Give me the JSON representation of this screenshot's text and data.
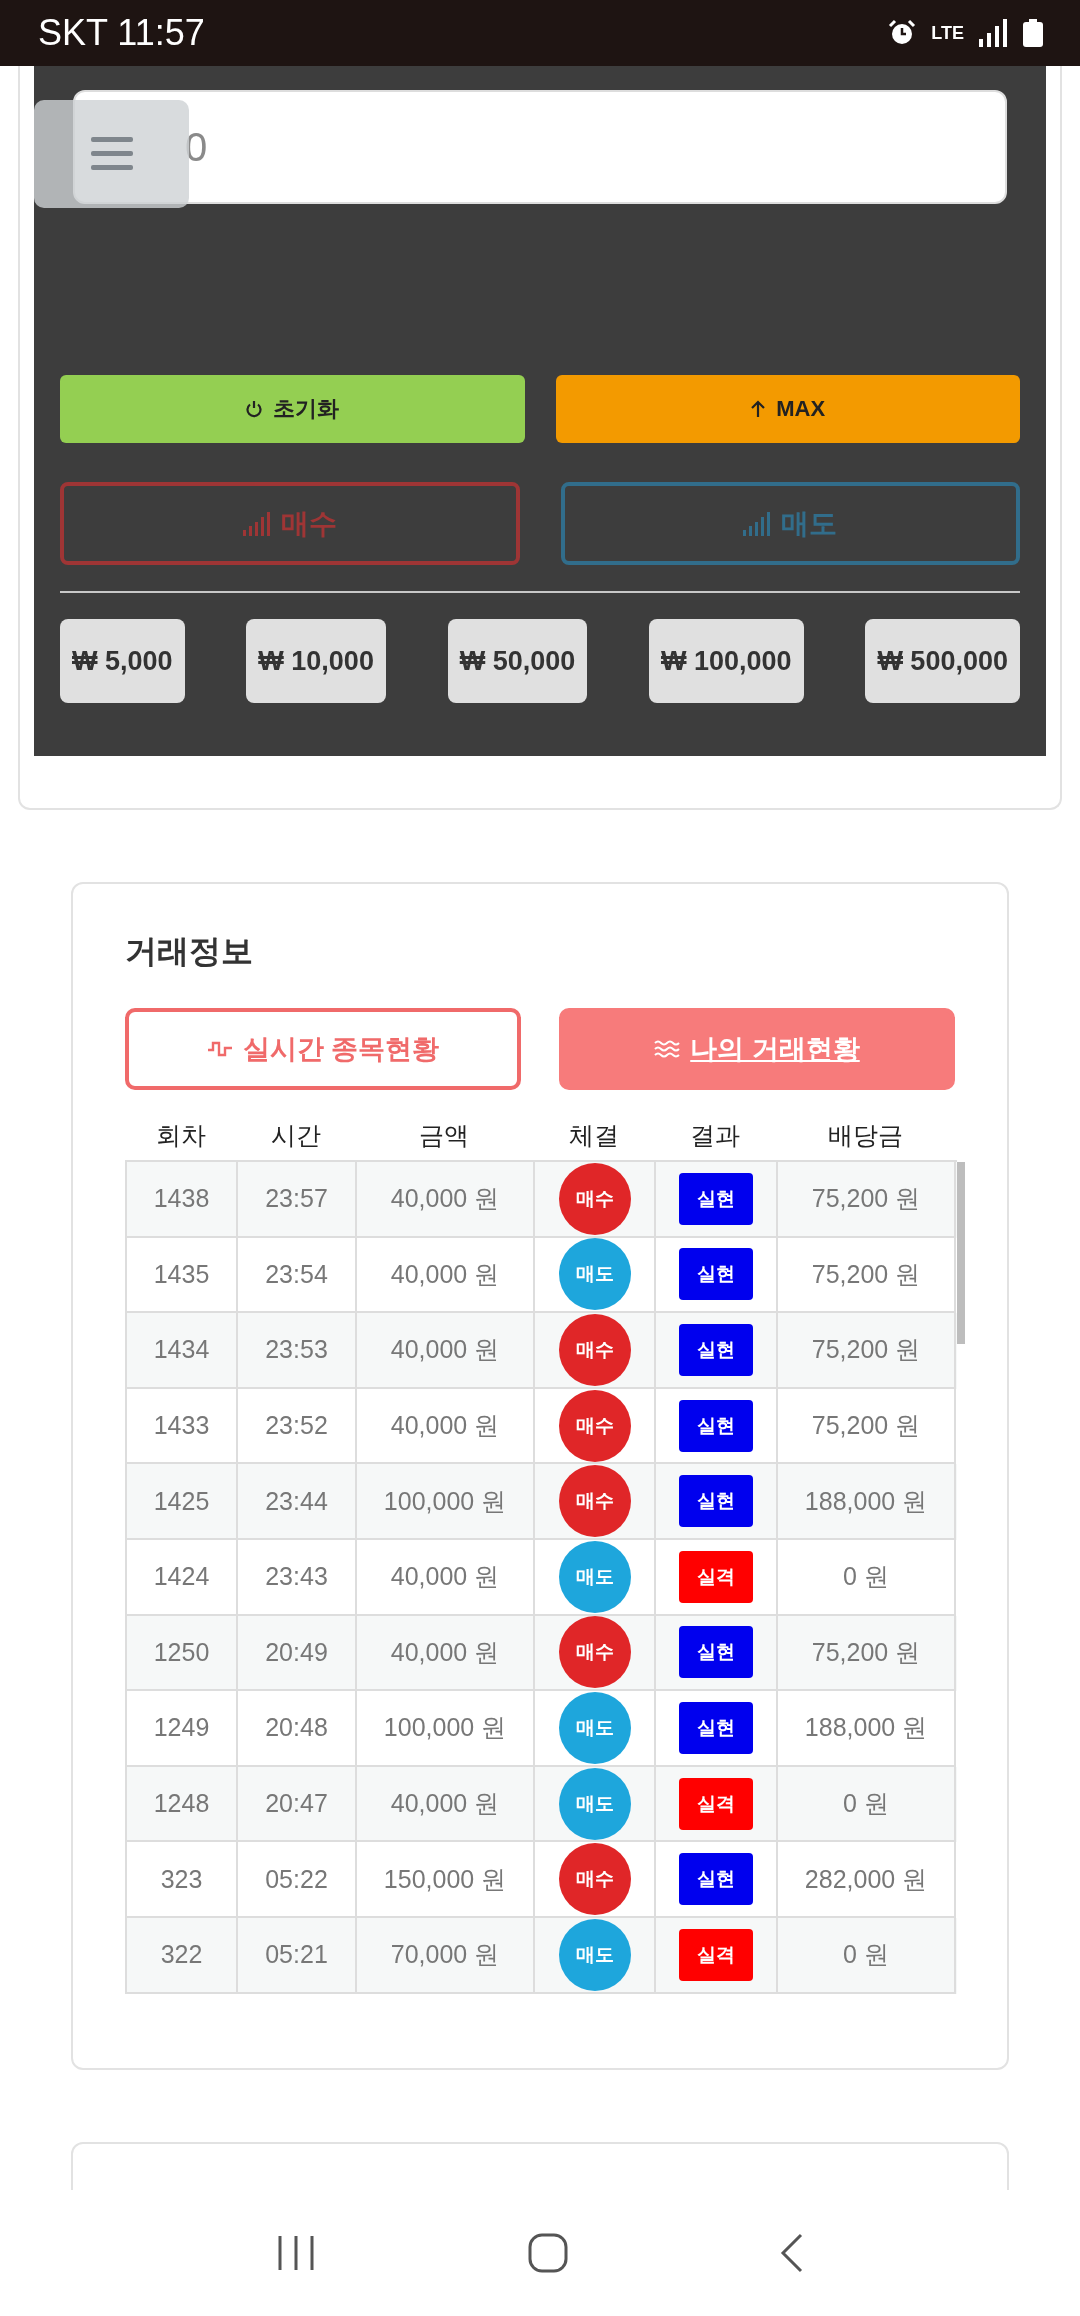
{
  "status_bar": {
    "carrier_time": "SKT 11:57",
    "network": "LTE"
  },
  "amount_input": {
    "placeholder": "0"
  },
  "action_buttons": [
    {
      "label": "초기화",
      "kind": "reset"
    },
    {
      "label": "MAX",
      "kind": "max"
    }
  ],
  "trade_buttons": [
    {
      "label": "매수",
      "kind": "buy",
      "disabled": true
    },
    {
      "label": "매도",
      "kind": "sell",
      "disabled": true
    }
  ],
  "amount_buttons": [
    "₩ 5,000",
    "₩ 10,000",
    "₩ 50,000",
    "₩ 100,000",
    "₩ 500,000"
  ],
  "trade_info": {
    "title": "거래정보",
    "tabs": [
      {
        "label": "실시간 종목현황",
        "kind": "pulse",
        "selected": false
      },
      {
        "label": "나의 거래현황",
        "kind": "waves",
        "selected": true
      }
    ],
    "table": {
      "columns": [
        "회차",
        "시간",
        "금액",
        "체결",
        "결과",
        "배당금"
      ],
      "rows": [
        {
          "round": "1438",
          "time": "23:57",
          "amount": "40,000 원",
          "side": {
            "label": "매수",
            "kind": "buy"
          },
          "result": {
            "label": "실현",
            "kind": "win"
          },
          "payout": "75,200 원"
        },
        {
          "round": "1435",
          "time": "23:54",
          "amount": "40,000 원",
          "side": {
            "label": "매도",
            "kind": "sell"
          },
          "result": {
            "label": "실현",
            "kind": "win"
          },
          "payout": "75,200 원"
        },
        {
          "round": "1434",
          "time": "23:53",
          "amount": "40,000 원",
          "side": {
            "label": "매수",
            "kind": "buy"
          },
          "result": {
            "label": "실현",
            "kind": "win"
          },
          "payout": "75,200 원"
        },
        {
          "round": "1433",
          "time": "23:52",
          "amount": "40,000 원",
          "side": {
            "label": "매수",
            "kind": "buy"
          },
          "result": {
            "label": "실현",
            "kind": "win"
          },
          "payout": "75,200 원"
        },
        {
          "round": "1425",
          "time": "23:44",
          "amount": "100,000 원",
          "side": {
            "label": "매수",
            "kind": "buy"
          },
          "result": {
            "label": "실현",
            "kind": "win"
          },
          "payout": "188,000 원"
        },
        {
          "round": "1424",
          "time": "23:43",
          "amount": "40,000 원",
          "side": {
            "label": "매도",
            "kind": "sell"
          },
          "result": {
            "label": "실격",
            "kind": "lose"
          },
          "payout": "0 원"
        },
        {
          "round": "1250",
          "time": "20:49",
          "amount": "40,000 원",
          "side": {
            "label": "매수",
            "kind": "buy"
          },
          "result": {
            "label": "실현",
            "kind": "win"
          },
          "payout": "75,200 원"
        },
        {
          "round": "1249",
          "time": "20:48",
          "amount": "100,000 원",
          "side": {
            "label": "매도",
            "kind": "sell"
          },
          "result": {
            "label": "실현",
            "kind": "win"
          },
          "payout": "188,000 원"
        },
        {
          "round": "1248",
          "time": "20:47",
          "amount": "40,000 원",
          "side": {
            "label": "매도",
            "kind": "sell"
          },
          "result": {
            "label": "실격",
            "kind": "lose"
          },
          "payout": "0 원"
        },
        {
          "round": "323",
          "time": "05:22",
          "amount": "150,000 원",
          "side": {
            "label": "매수",
            "kind": "buy"
          },
          "result": {
            "label": "실현",
            "kind": "win"
          },
          "payout": "282,000 원"
        },
        {
          "round": "322",
          "time": "05:21",
          "amount": "70,000 원",
          "side": {
            "label": "매도",
            "kind": "sell"
          },
          "result": {
            "label": "실격",
            "kind": "lose"
          },
          "payout": "0 원"
        }
      ]
    }
  }
}
